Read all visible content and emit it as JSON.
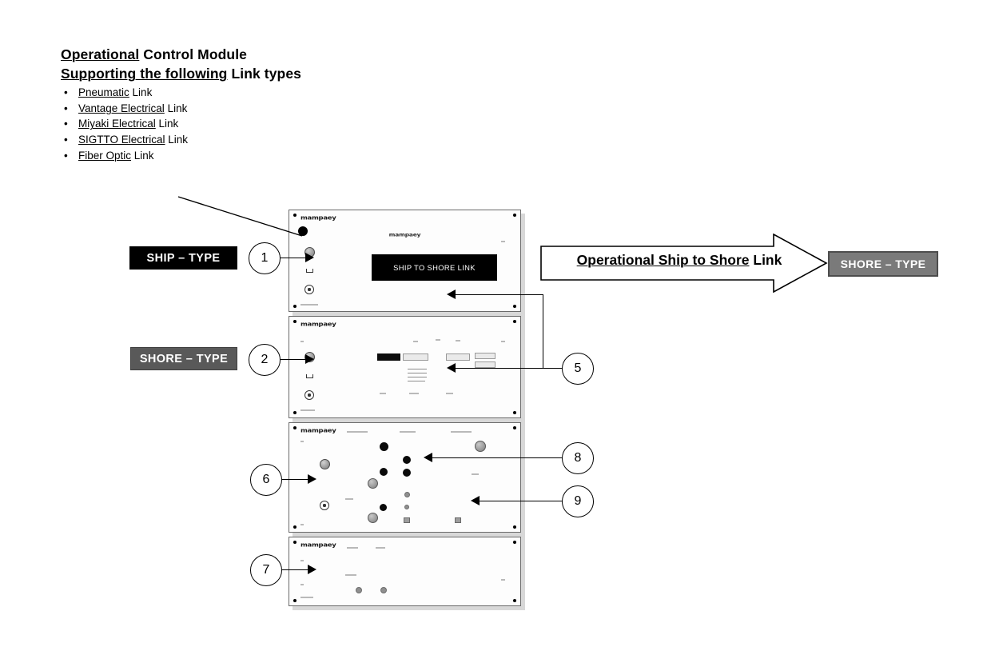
{
  "header": {
    "title_line1_underlined": "Operational",
    "title_line1_rest": " Control Module",
    "title_line2_underlined": "Supporting the following",
    "title_line2_rest": " Link types",
    "bullets": [
      {
        "underlined": "Pneumatic",
        "rest": " Link"
      },
      {
        "underlined": "Vantage Electrical",
        "rest": " Link"
      },
      {
        "underlined": "Miyaki Electrical",
        "rest": " Link"
      },
      {
        "underlined": "SIGTTO Electrical",
        "rest": " Link"
      },
      {
        "underlined": "Fiber Optic",
        "rest": " Link"
      }
    ],
    "bullet_glyph": "•"
  },
  "chips": {
    "ship_type": "SHIP – TYPE",
    "shore_type_left": "SHORE – TYPE",
    "shore_type_right": "SHORE – TYPE"
  },
  "banner": {
    "underlined": "Operational",
    "mid": " Ship to Shore",
    "rest": " Link",
    "direction": "right"
  },
  "callouts": [
    {
      "id": "1",
      "number": "1"
    },
    {
      "id": "2",
      "number": "2"
    },
    {
      "id": "5",
      "number": "5"
    },
    {
      "id": "6",
      "number": "6"
    },
    {
      "id": "7",
      "number": "7"
    },
    {
      "id": "8",
      "number": "8"
    },
    {
      "id": "9",
      "number": "9"
    }
  ],
  "rack": {
    "brand": "mampaey",
    "panels": [
      {
        "name": "ship-to-shore-link-panel",
        "brand": "mampaey",
        "brand_center": "mampaey",
        "display_text": "SHIP TO SHORE LINK"
      },
      {
        "name": "hmi-screen-panel",
        "brand": "mampaey",
        "display_text": ""
      },
      {
        "name": "indicator-lamp-panel",
        "brand": "mampaey",
        "display_text": ""
      },
      {
        "name": "blank-lower-panel",
        "brand": "mampaey",
        "display_text": ""
      }
    ]
  },
  "colors": {
    "ship_chip_bg": "#000000",
    "shore_chip_bg": "#595959",
    "shore_chip_right_bg": "#7a7a7a",
    "display_bg": "#000000",
    "display_fg": "#ffffff",
    "line": "#000000",
    "panel_bg": "#fdfdfd"
  }
}
